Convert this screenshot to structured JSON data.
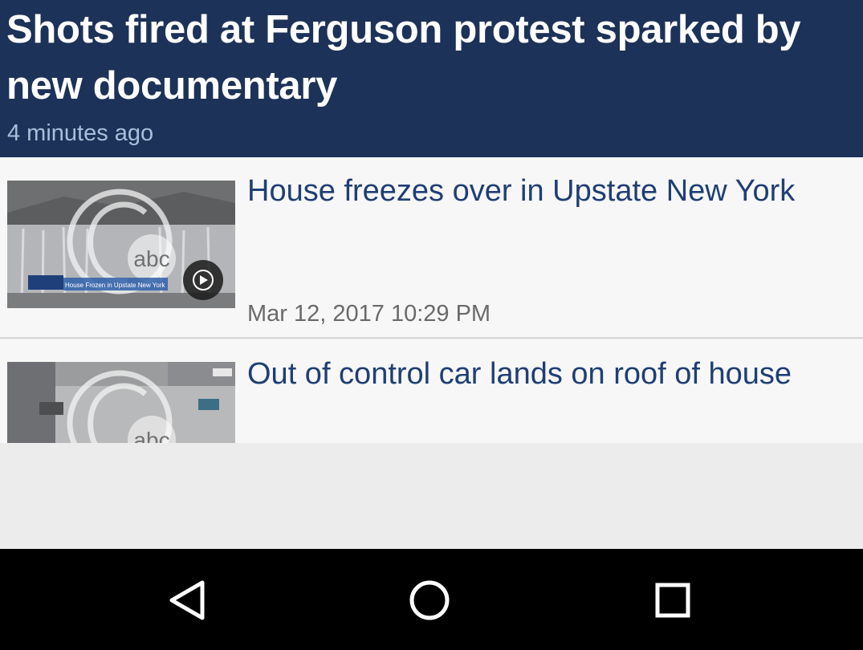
{
  "headline": {
    "title": "Shots fired at Ferguson protest sparked by new documentary",
    "time": "4 minutes ago"
  },
  "stories": [
    {
      "title": "House freezes over in Upstate New York",
      "date": "Mar 12, 2017 10:29 PM",
      "thumbnail_caption": "House Frozen in Upstate New York",
      "has_video": true
    },
    {
      "title": "Out of control car lands on roof of house"
    }
  ],
  "navbar": {
    "back_icon": "back-triangle-icon",
    "home_icon": "home-circle-icon",
    "recents_icon": "recents-square-icon"
  },
  "colors": {
    "header_bg": "#1c3258",
    "story_title": "#1f3f74",
    "navbar_bg": "#000000"
  }
}
